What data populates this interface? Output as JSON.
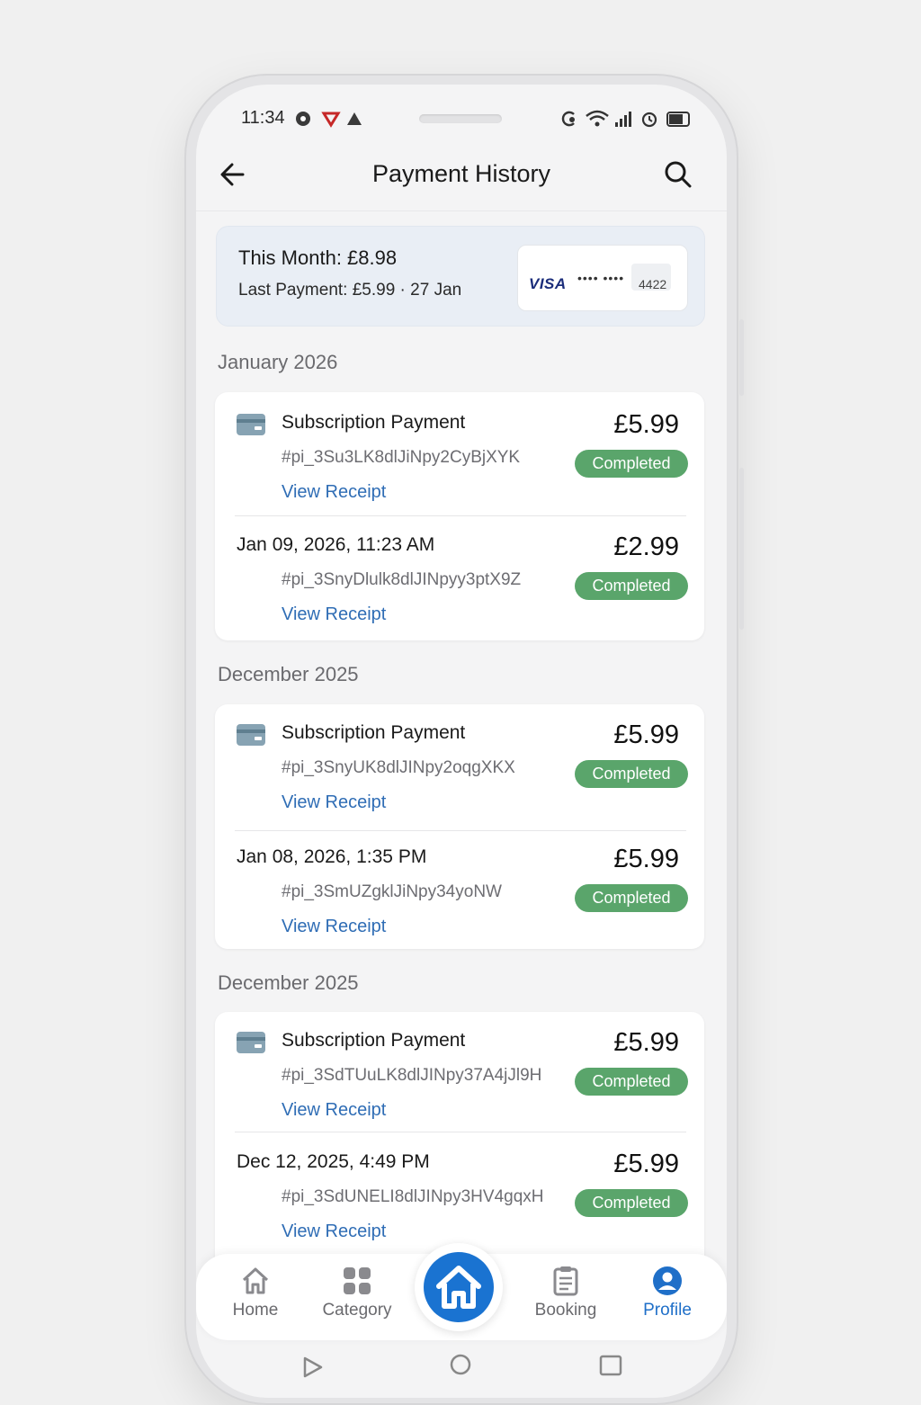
{
  "status_bar": {
    "time": "11:34"
  },
  "header": {
    "title": "Payment History",
    "back_icon": "arrow-left-icon",
    "search_icon": "search-icon"
  },
  "summary": {
    "month_total": "This Month: £8.98",
    "last_payment": "Last Payment: £5.99 · 27 Jan",
    "card": {
      "brand": "VISA",
      "masked": "•••• ••••",
      "last4": "4422"
    }
  },
  "sections": [
    {
      "title": "January 2026",
      "items": [
        {
          "label": "Subscription Payment",
          "id": "#pi_3Su3LK8dlJiNpy2CyBjXYK",
          "receipt": "View Receipt",
          "amount": "£5.99",
          "status": "Completed"
        },
        {
          "label": "Jan 09, 2026, 11:23 AM",
          "id": "#pi_3SnyDlulk8dlJINpyy3ptX9Z",
          "receipt": "View Receipt",
          "amount": "£2.99",
          "status": "Completed"
        }
      ]
    },
    {
      "title": "December 2025",
      "items": [
        {
          "label": "Subscription Payment",
          "id": "#pi_3SnyUK8dlJINpy2oqgXKX",
          "receipt": "View Receipt",
          "amount": "£5.99",
          "status": "Completed"
        },
        {
          "label": "Jan 08, 2026, 1:35 PM",
          "id": "#pi_3SmUZgklJiNpy34yoNW",
          "receipt": "View Receipt",
          "amount": "£5.99",
          "status": "Completed"
        }
      ]
    },
    {
      "title": "December 2025",
      "items": [
        {
          "label": "Subscription Payment",
          "id": "#pi_3SdTUuLK8dlJINpy37A4jJl9H",
          "receipt": "View Receipt",
          "amount": "£5.99",
          "status": "Completed"
        },
        {
          "label": "Dec 12, 2025, 4:49 PM",
          "id": "#pi_3SdUNELI8dlJINpy3HV4gqxH",
          "receipt": "View Receipt",
          "amount": "£5.99",
          "status": "Completed"
        }
      ]
    }
  ],
  "nav": {
    "home": "Home",
    "category": "Category",
    "booking": "Booking",
    "profile": "Profile",
    "active": "Profile"
  },
  "colors": {
    "accent": "#1a73d1",
    "link": "#2f6db5",
    "status_completed": "#5aa56b"
  }
}
